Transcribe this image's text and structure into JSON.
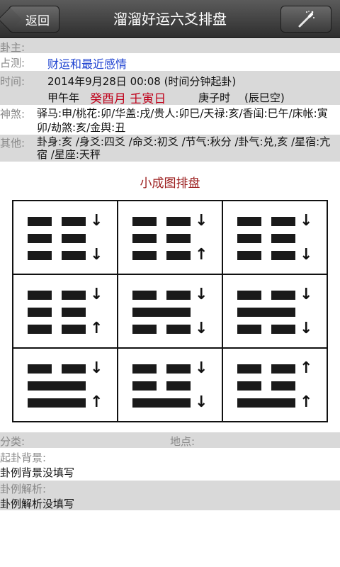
{
  "header": {
    "back_label": "返回",
    "title": "溜溜好运六爻排盘",
    "wand_icon": "magic-wand-icon"
  },
  "info": {
    "gua_zhu_label": "卦主:",
    "zhan_ce_label": "占测:",
    "zhan_ce_value": "财运和最近感情",
    "time_label": "时间:",
    "time_value": "2014年9月28日 00:08 (时间分钟起卦)",
    "ganzhi_year": "甲午年",
    "ganzhi_month_day": "癸酉月 壬寅日",
    "ganzhi_hour": "庚子时",
    "kong": "(辰巳空)",
    "shensha_label": "神煞:",
    "shensha_value": "驿马:申/桃花:卯/华盖:戌/贵人:卯巳/天禄:亥/香闺:巳午/床帐:寅卯/劫煞:亥/金舆:丑",
    "other_label": "其他:",
    "other_value": "卦身:亥 /身爻:四爻 /命爻:初爻 /节气:秋分 /卦气:兑,亥 /星宿:亢宿 /星座:天秤"
  },
  "chart_title": "小成图排盘",
  "cells": [
    {
      "lines": [
        {
          "type": "yin",
          "arrow": "↓"
        },
        {
          "type": "yin",
          "arrow": ""
        },
        {
          "type": "yin",
          "arrow": "↓"
        }
      ]
    },
    {
      "lines": [
        {
          "type": "yin",
          "arrow": "↓"
        },
        {
          "type": "yin",
          "arrow": ""
        },
        {
          "type": "yin",
          "arrow": "↑"
        }
      ]
    },
    {
      "lines": [
        {
          "type": "yin",
          "arrow": "↓"
        },
        {
          "type": "yin",
          "arrow": ""
        },
        {
          "type": "yin",
          "arrow": "↓"
        }
      ]
    },
    {
      "lines": [
        {
          "type": "yin",
          "arrow": "↓"
        },
        {
          "type": "yin",
          "arrow": ""
        },
        {
          "type": "yin",
          "arrow": "↑"
        }
      ]
    },
    {
      "lines": [
        {
          "type": "yin",
          "arrow": "↓"
        },
        {
          "type": "yang",
          "arrow": ""
        },
        {
          "type": "yin",
          "arrow": "↓"
        }
      ]
    },
    {
      "lines": [
        {
          "type": "yin",
          "arrow": "↓"
        },
        {
          "type": "yang",
          "arrow": ""
        },
        {
          "type": "yin",
          "arrow": "↓"
        }
      ]
    },
    {
      "lines": [
        {
          "type": "yin",
          "arrow": "↓"
        },
        {
          "type": "yang",
          "arrow": ""
        },
        {
          "type": "yang",
          "arrow": "↑"
        }
      ]
    },
    {
      "lines": [
        {
          "type": "yin",
          "arrow": "↓"
        },
        {
          "type": "yin",
          "arrow": ""
        },
        {
          "type": "yang",
          "arrow": "↓"
        }
      ]
    },
    {
      "lines": [
        {
          "type": "yin",
          "arrow": "↑"
        },
        {
          "type": "yin",
          "arrow": ""
        },
        {
          "type": "yang",
          "arrow": "↑"
        }
      ]
    }
  ],
  "footer": {
    "category_label": "分类:",
    "location_label": "地点:",
    "background_label": "起卦背景:",
    "background_value": "卦例背景没填写",
    "analysis_label": "卦例解析:",
    "analysis_value": "卦例解析没填写"
  }
}
